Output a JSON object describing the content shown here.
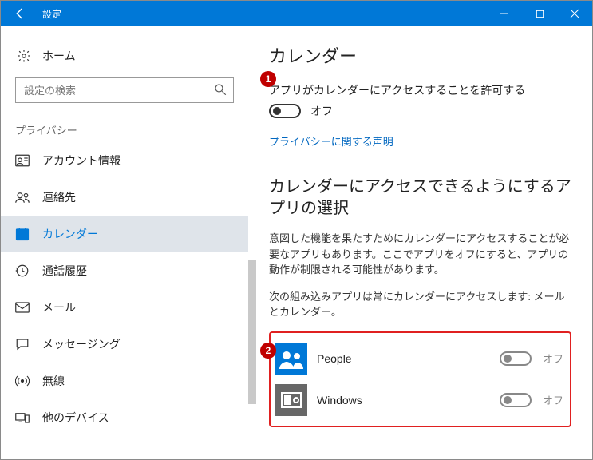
{
  "titlebar": {
    "title": "設定"
  },
  "sidebar": {
    "home": "ホーム",
    "search_placeholder": "設定の検索",
    "group": "プライバシー",
    "items": [
      {
        "label": "アカウント情報"
      },
      {
        "label": "連絡先"
      },
      {
        "label": "カレンダー"
      },
      {
        "label": "通話履歴"
      },
      {
        "label": "メール"
      },
      {
        "label": "メッセージング"
      },
      {
        "label": "無線"
      },
      {
        "label": "他のデバイス"
      }
    ]
  },
  "main": {
    "heading": "カレンダー",
    "permission_label": "アプリがカレンダーにアクセスすることを許可する",
    "permission_state": "オフ",
    "privacy_link": "プライバシーに関する声明",
    "section_heading": "カレンダーにアクセスできるようにするアプリの選択",
    "section_desc": "意図した機能を果たすためにカレンダーにアクセスすることが必要なアプリもあります。ここでアプリをオフにすると、アプリの動作が制限される可能性があります。",
    "builtin_note": "次の組み込みアプリは常にカレンダーにアクセスします: メールとカレンダー。",
    "apps": [
      {
        "name": "People",
        "state": "オフ"
      },
      {
        "name": "Windows",
        "state": "オフ"
      }
    ]
  },
  "annotations": {
    "one": "1",
    "two": "2"
  }
}
